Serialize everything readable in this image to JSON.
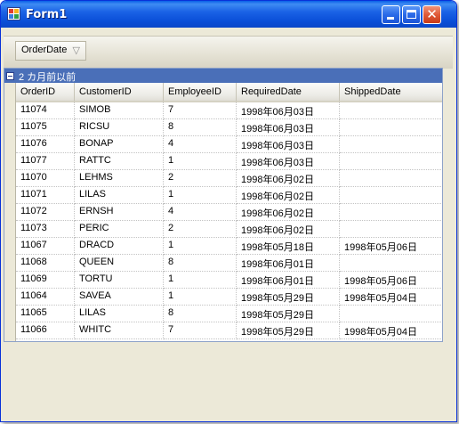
{
  "window": {
    "title": "Form1"
  },
  "group_panel": {
    "chip_label": "OrderDate",
    "chip_icon": "filter-icon"
  },
  "group_row": {
    "label": "2 カ月前以前"
  },
  "columns": [
    "OrderID",
    "CustomerID",
    "EmployeeID",
    "RequiredDate",
    "ShippedDate"
  ],
  "rows": [
    [
      "11074",
      "SIMOB",
      "7",
      "1998年06月03日",
      ""
    ],
    [
      "11075",
      "RICSU",
      "8",
      "1998年06月03日",
      ""
    ],
    [
      "11076",
      "BONAP",
      "4",
      "1998年06月03日",
      ""
    ],
    [
      "11077",
      "RATTC",
      "1",
      "1998年06月03日",
      ""
    ],
    [
      "11070",
      "LEHMS",
      "2",
      "1998年06月02日",
      ""
    ],
    [
      "11071",
      "LILAS",
      "1",
      "1998年06月02日",
      ""
    ],
    [
      "11072",
      "ERNSH",
      "4",
      "1998年06月02日",
      ""
    ],
    [
      "11073",
      "PERIC",
      "2",
      "1998年06月02日",
      ""
    ],
    [
      "11067",
      "DRACD",
      "1",
      "1998年05月18日",
      "1998年05月06日"
    ],
    [
      "11068",
      "QUEEN",
      "8",
      "1998年06月01日",
      ""
    ],
    [
      "11069",
      "TORTU",
      "1",
      "1998年06月01日",
      "1998年05月06日"
    ],
    [
      "11064",
      "SAVEA",
      "1",
      "1998年05月29日",
      "1998年05月04日"
    ],
    [
      "11065",
      "LILAS",
      "8",
      "1998年05月29日",
      ""
    ],
    [
      "11066",
      "WHITC",
      "7",
      "1998年05月29日",
      "1998年05月04日"
    ]
  ]
}
